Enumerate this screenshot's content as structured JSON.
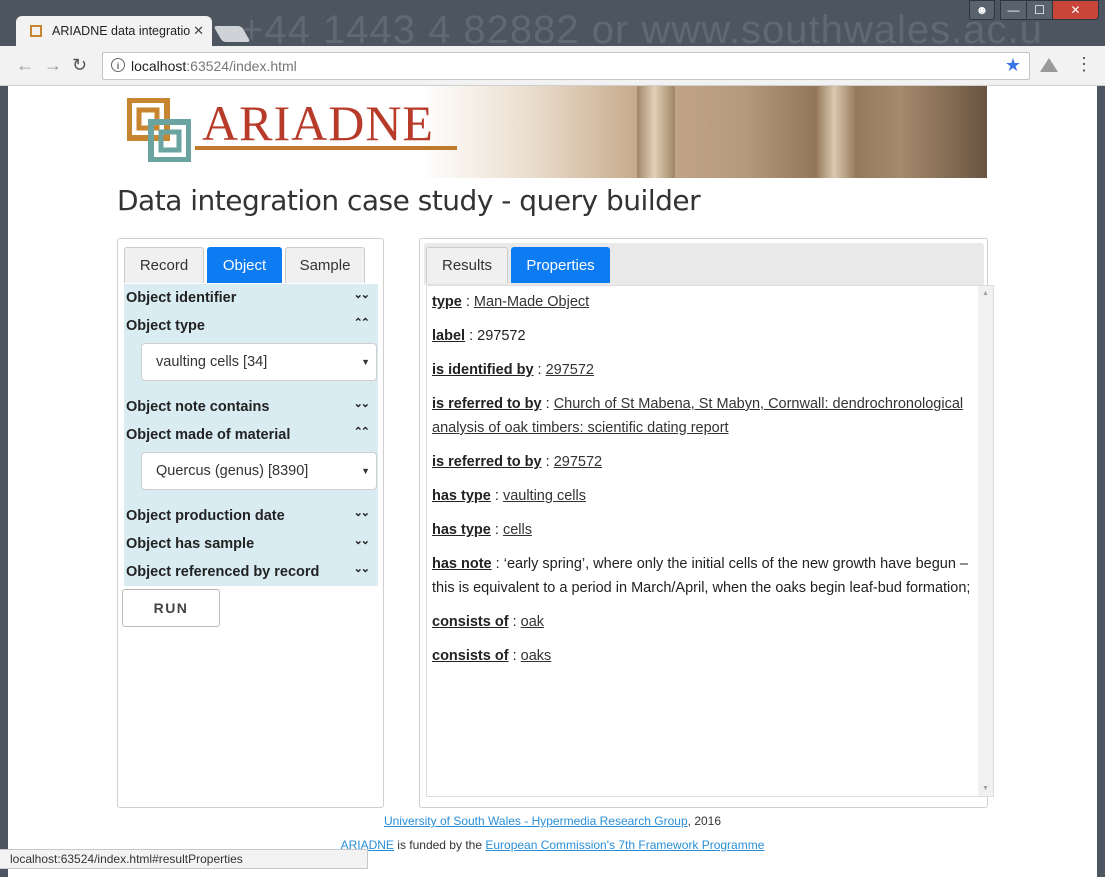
{
  "browser": {
    "tab_title": "ARIADNE data integratio",
    "tab_close": "✕",
    "url_host": "localhost",
    "url_path": ":63524/index.html",
    "status_text": "localhost:63524/index.html#resultProperties",
    "background_text": "+44 1443 4 82882 or www.southwales.ac.u",
    "window_controls": {
      "minimize": "—",
      "maximize": "☐",
      "close": "✕"
    },
    "accent_color": "#3b78e7"
  },
  "banner": {
    "logo_text": "ARIADNE"
  },
  "page_title": "Data integration case study - query builder",
  "left": {
    "tabs": [
      {
        "label": "Record"
      },
      {
        "label": "Object"
      },
      {
        "label": "Sample"
      }
    ],
    "active_tab": "Object",
    "facets": {
      "identifier": "Object identifier",
      "type": "Object type",
      "type_value": "vaulting cells [34]",
      "note": "Object note contains",
      "material": "Object made of material",
      "material_value": "Quercus (genus) [8390]",
      "production_date": "Object production date",
      "has_sample": "Object has sample",
      "referenced_by": "Object referenced by record"
    },
    "run_label": "RUN"
  },
  "right": {
    "tabs": [
      {
        "label": "Results"
      },
      {
        "label": "Properties"
      }
    ],
    "active_tab": "Properties",
    "properties": [
      {
        "key": "type",
        "value": "Man-Made Object",
        "link": true
      },
      {
        "key": "label",
        "value": "297572",
        "link": false
      },
      {
        "key": "is identified by",
        "value": "297572",
        "link": true
      },
      {
        "key": "is referred to by",
        "value": "Church of St Mabena, St Mabyn, Cornwall: dendrochronological analysis of oak timbers: scientific dating report",
        "link": true
      },
      {
        "key": "is referred to by",
        "value": "297572",
        "link": true
      },
      {
        "key": "has type",
        "value": "vaulting cells",
        "link": true
      },
      {
        "key": "has type",
        "value": "cells",
        "link": true
      },
      {
        "key": "has note",
        "value": "‘early spring’, where only the initial cells of the new growth have begun – this is equivalent to a period in March/April, when the oaks begin leaf-bud formation;",
        "link": false
      },
      {
        "key": "consists of",
        "value": "oak",
        "link": true
      },
      {
        "key": "consists of",
        "value": "oaks",
        "link": true
      }
    ]
  },
  "footer": {
    "line1_link": "University of South Wales - Hypermedia Research Group",
    "line1_suffix": ", 2016",
    "line2_link1": "ARIADNE",
    "line2_middle": " is funded by the ",
    "line2_link2": "European Commission's 7th Framework Programme"
  }
}
